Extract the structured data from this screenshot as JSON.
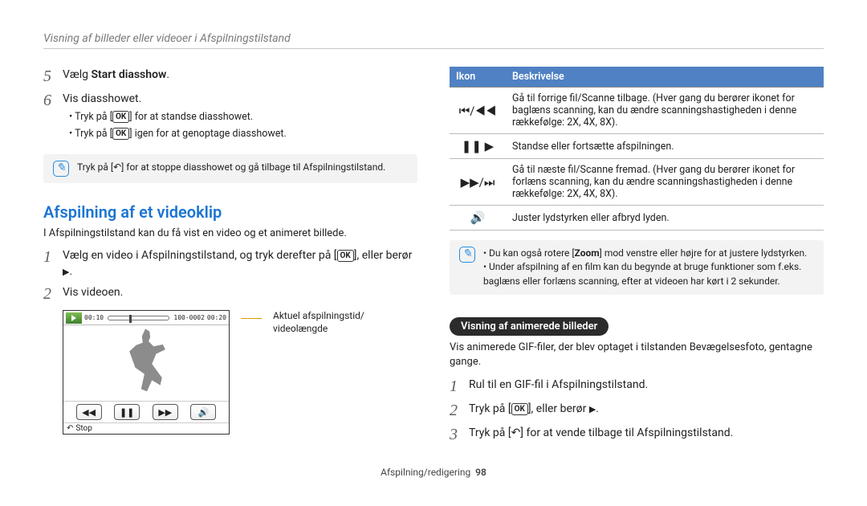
{
  "header": "Visning af billeder eller videoer i Afspilningstilstand",
  "left": {
    "steps_a": [
      {
        "n": "5",
        "pre": "Vælg ",
        "bold": "Start diasshow",
        "post": "."
      },
      {
        "n": "6",
        "text": "Vis diasshowet."
      }
    ],
    "bullets_a": [
      "Tryk på [OK] for at standse diasshowet.",
      "Tryk på [OK] igen for at genoptage diasshowet."
    ],
    "note_a": "Tryk på [↶] for at stoppe diasshowet og gå tilbage til Afspilningstilstand.",
    "section": "Afspilning af et videoklip",
    "desc": "I Afspilningstilstand kan du få vist en video og et animeret billede.",
    "steps_b": [
      {
        "n": "1",
        "text": "Vælg en video i Afspilningstilstand, og tryk derefter på [OK], eller berør ▶."
      },
      {
        "n": "2",
        "text": "Vis videoen."
      }
    ],
    "player": {
      "t_left": "00:10",
      "t_right": "00:20",
      "counter": "100-0002",
      "stop": "Stop"
    },
    "annot": "Aktuel afspilningstid/\nvideolængde"
  },
  "right": {
    "table": {
      "h1": "Ikon",
      "h2": "Beskrivelse",
      "rows": [
        {
          "icon": "⏮/◀◀",
          "text": "Gå til forrige fil/Scanne tilbage. (Hver gang du berører ikonet for baglæns scanning, kan du ændre scanningshastigheden i denne rækkefølge: 2X, 4X, 8X)."
        },
        {
          "icon": "❚❚ ▶",
          "text": "Standse eller fortsætte afspilningen."
        },
        {
          "icon": "▶▶/⏭",
          "text": "Gå til næste fil/Scanne fremad. (Hver gang du berører ikonet for forlæns scanning, kan du ændre scanningshastigheden i denne rækkefølge: 2X, 4X, 8X)."
        },
        {
          "icon": "🔊",
          "text": "Juster lydstyrken eller afbryd lyden."
        }
      ]
    },
    "note_lines": [
      "Du kan også rotere [Zoom] mod venstre eller højre for at justere lydstyrken.",
      "Under afspilning af en film kan du begynde at bruge funktioner som f.eks. baglæns eller forlæns scanning, efter at videoen har kørt i 2 sekunder."
    ],
    "pill": "Visning af animerede billeder",
    "desc2": "Vis animerede GIF-filer, der blev optaget i tilstanden Bevægelsesfoto, gentagne gange.",
    "steps_c": [
      {
        "n": "1",
        "text": "Rul til en GIF-fil i Afspilningstilstand."
      },
      {
        "n": "2",
        "text": "Tryk på [OK], eller berør ▶."
      },
      {
        "n": "3",
        "text": "Tryk på [↶] for at vende tilbage til Afspilningstilstand."
      }
    ]
  },
  "footer": {
    "text": "Afspilning/redigering",
    "page": "98"
  }
}
